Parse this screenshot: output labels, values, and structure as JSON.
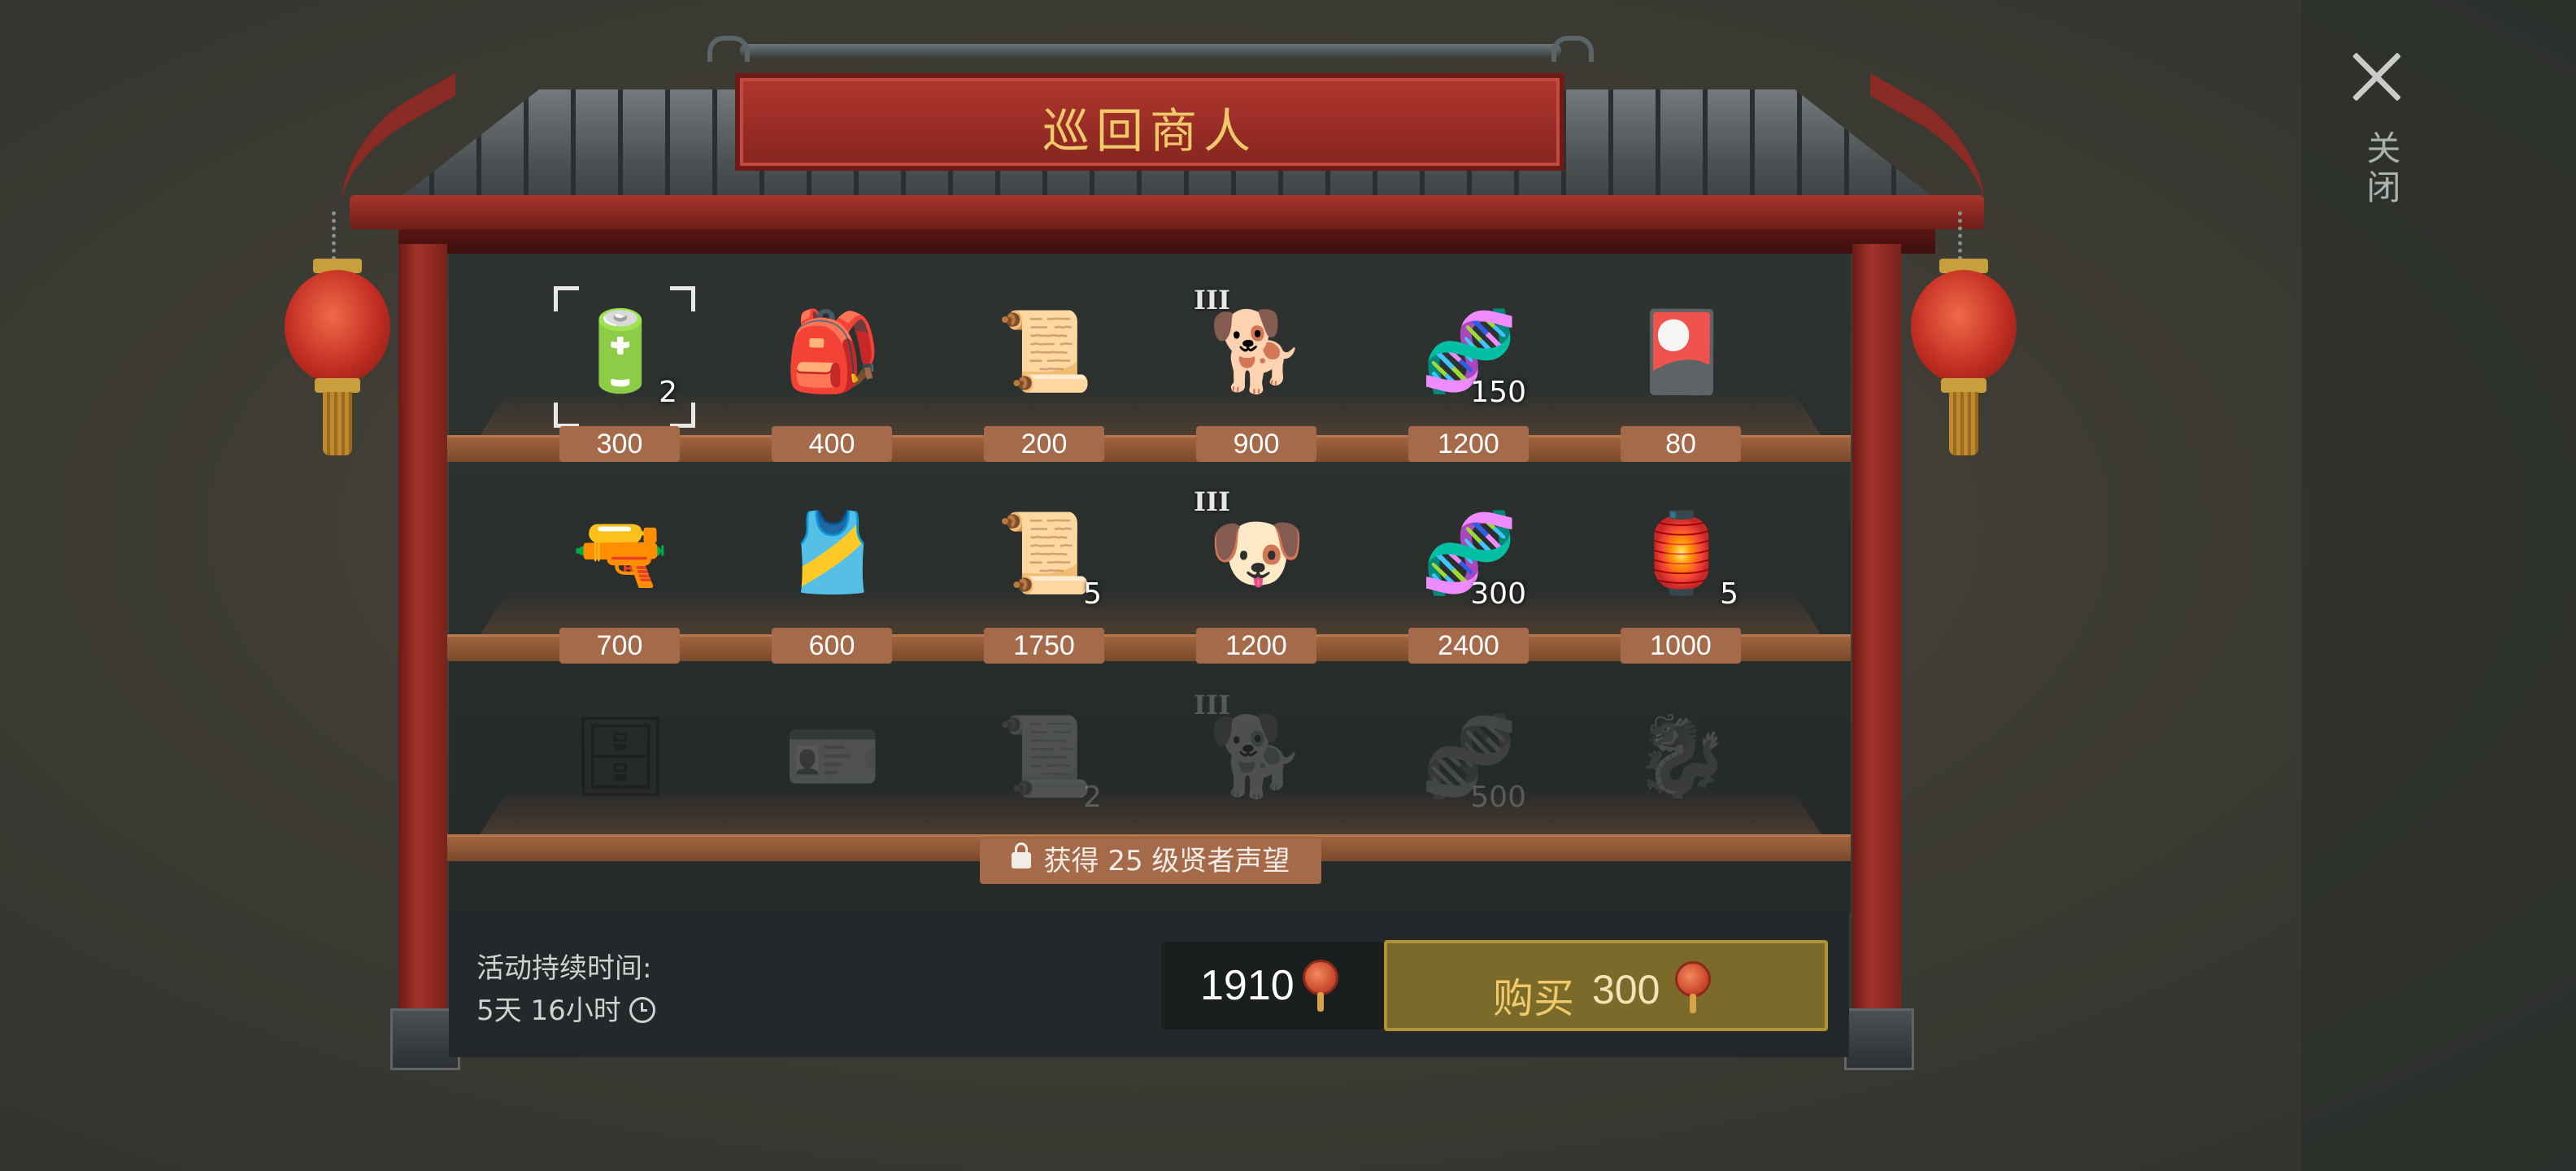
{
  "title": "巡回商人",
  "close": {
    "label": "关闭"
  },
  "colors": {
    "plaque": "#a8322a",
    "price_tag": "#a56a4a",
    "buy_button": "#7c6a2a",
    "buy_text": "#efc96a"
  },
  "shelves": [
    {
      "items": [
        {
          "name": "car-battery",
          "icon": "🔋",
          "qty": "2",
          "tier": "",
          "price": "300",
          "selected": true
        },
        {
          "name": "backpack",
          "icon": "🎒",
          "qty": "",
          "tier": "",
          "price": "400"
        },
        {
          "name": "scroll",
          "icon": "📜",
          "qty": "",
          "tier": "",
          "price": "200"
        },
        {
          "name": "husky-dog",
          "icon": "🐕",
          "qty": "",
          "tier": "III",
          "price": "900"
        },
        {
          "name": "dna-capsule",
          "icon": "🧬",
          "qty": "150",
          "tier": "",
          "price": "1200"
        },
        {
          "name": "martial-arts-card",
          "icon": "🎴",
          "qty": "",
          "tier": "",
          "price": "80"
        }
      ]
    },
    {
      "items": [
        {
          "name": "sniper-rifle",
          "icon": "🔫",
          "qty": "",
          "tier": "",
          "price": "700"
        },
        {
          "name": "vest-outfit",
          "icon": "🎽",
          "qty": "",
          "tier": "",
          "price": "600"
        },
        {
          "name": "scroll",
          "icon": "📜",
          "qty": "5",
          "tier": "",
          "price": "1750"
        },
        {
          "name": "saint-bernard-dog",
          "icon": "🐶",
          "qty": "",
          "tier": "III",
          "price": "1200"
        },
        {
          "name": "dna-capsule",
          "icon": "🧬",
          "qty": "300",
          "tier": "",
          "price": "2400"
        },
        {
          "name": "lantern-string",
          "icon": "🏮",
          "qty": "5",
          "tier": "",
          "price": "1000"
        }
      ]
    },
    {
      "items": [
        {
          "name": "locker",
          "icon": "🗄",
          "qty": "",
          "tier": ""
        },
        {
          "name": "photo-badge",
          "icon": "🪪",
          "qty": "",
          "tier": ""
        },
        {
          "name": "scroll",
          "icon": "📜",
          "qty": "2",
          "tier": ""
        },
        {
          "name": "dark-dog",
          "icon": "🐕",
          "qty": "",
          "tier": "III"
        },
        {
          "name": "dna-capsule",
          "icon": "🧬",
          "qty": "500",
          "tier": ""
        },
        {
          "name": "dragon-statue",
          "icon": "🐉",
          "qty": "",
          "tier": ""
        }
      ]
    }
  ],
  "lock": {
    "text": "获得 25 级贤者声望"
  },
  "duration": {
    "label": "活动持续时间:",
    "value": "5天 16小时"
  },
  "currency": {
    "amount": "1910",
    "icon": "red-fan-currency"
  },
  "buy": {
    "label": "购买",
    "price": "300"
  }
}
